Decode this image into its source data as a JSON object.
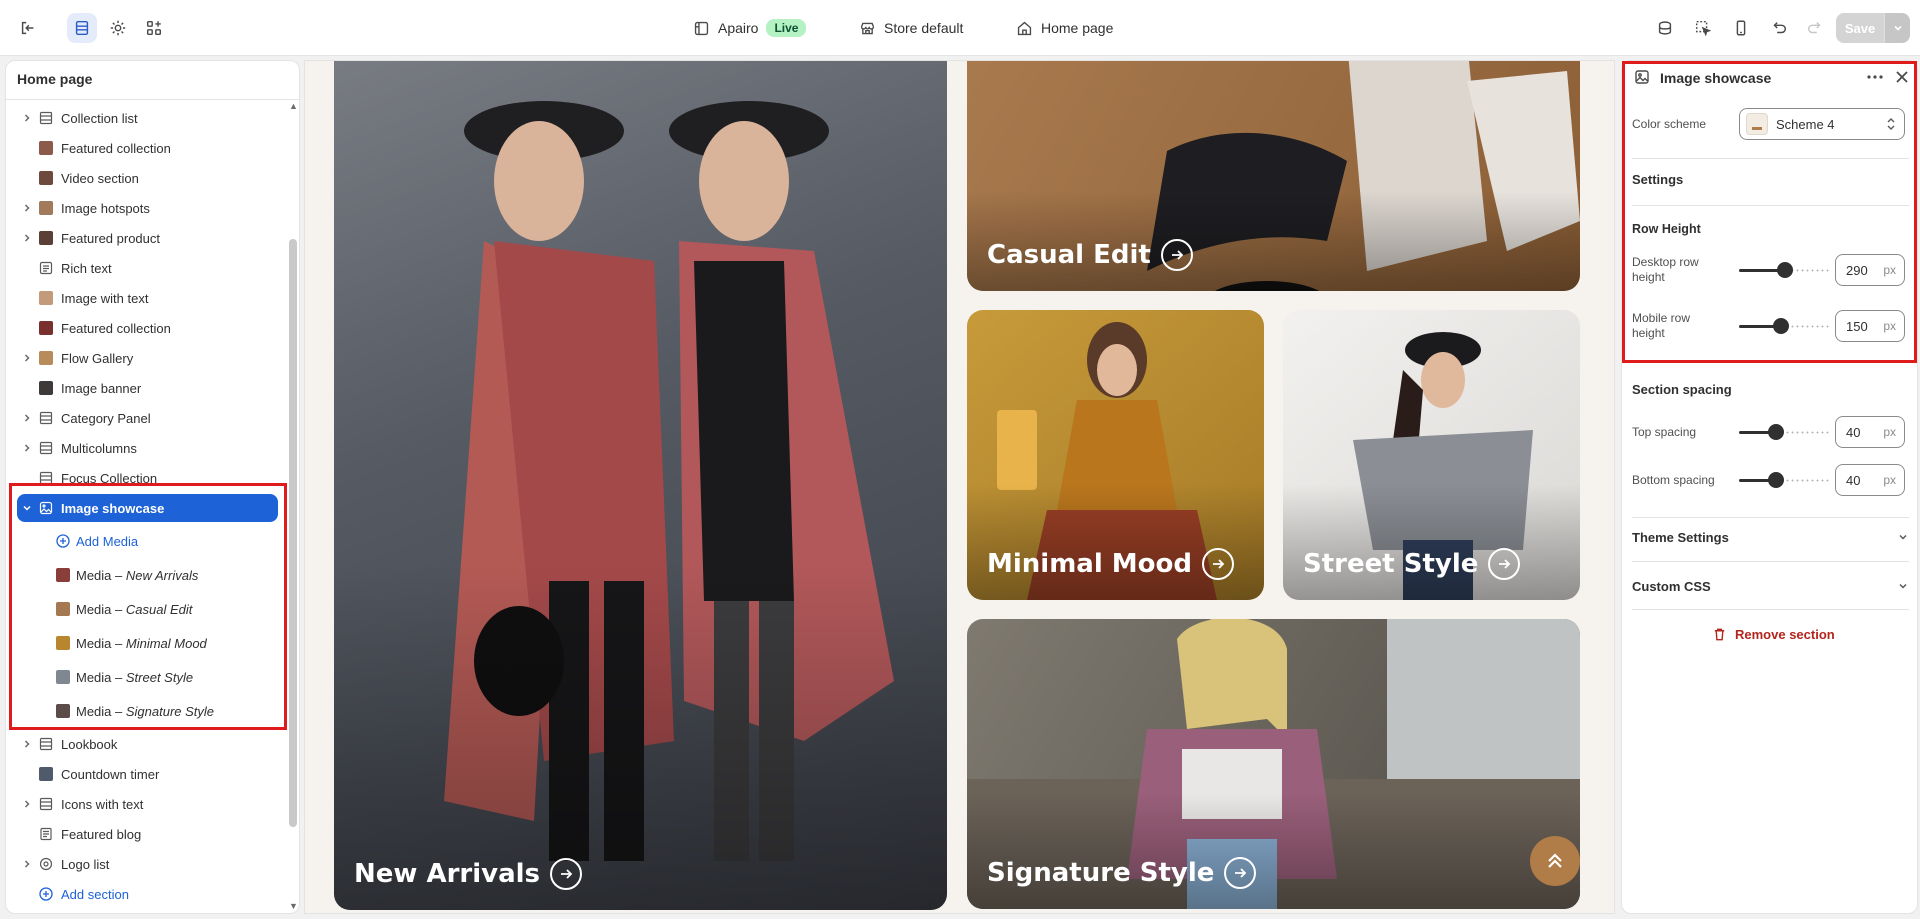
{
  "topbar": {
    "store_name": "Apairo",
    "status_badge": "Live",
    "theme_label": "Store default",
    "page_label": "Home page",
    "save_label": "Save"
  },
  "sidebar": {
    "title": "Home page",
    "items": [
      {
        "label": "Collection list",
        "expandable": true,
        "icon": "section-list-icon"
      },
      {
        "label": "Featured collection",
        "expandable": false,
        "icon": "thumbnail"
      },
      {
        "label": "Video section",
        "expandable": false,
        "icon": "thumbnail"
      },
      {
        "label": "Image hotspots",
        "expandable": true,
        "icon": "thumbnail"
      },
      {
        "label": "Featured product",
        "expandable": true,
        "icon": "thumbnail"
      },
      {
        "label": "Rich text",
        "expandable": false,
        "icon": "text-block-icon"
      },
      {
        "label": "Image with text",
        "expandable": false,
        "icon": "thumbnail"
      },
      {
        "label": "Featured collection",
        "expandable": false,
        "icon": "thumbnail"
      },
      {
        "label": "Flow Gallery",
        "expandable": true,
        "icon": "thumbnail"
      },
      {
        "label": "Image banner",
        "expandable": false,
        "icon": "thumbnail"
      },
      {
        "label": "Category Panel",
        "expandable": true,
        "icon": "section-list-icon"
      },
      {
        "label": "Multicolumns",
        "expandable": true,
        "icon": "section-list-icon"
      },
      {
        "label": "Focus Collection",
        "expandable": false,
        "icon": "section-list-icon"
      }
    ],
    "selected": {
      "label": "Image showcase",
      "icon": "image-showcase-icon"
    },
    "add_media": "Add Media",
    "media_prefix": "Media – ",
    "media_items": [
      "New Arrivals",
      "Casual Edit",
      "Minimal Mood",
      "Street Style",
      "Signature Style"
    ],
    "after_items": [
      {
        "label": "Lookbook",
        "expandable": true,
        "icon": "section-list-icon"
      },
      {
        "label": "Countdown timer",
        "expandable": false,
        "icon": "thumbnail"
      },
      {
        "label": "Icons with text",
        "expandable": true,
        "icon": "section-list-icon"
      },
      {
        "label": "Featured blog",
        "expandable": false,
        "icon": "blog-icon"
      },
      {
        "label": "Logo list",
        "expandable": true,
        "icon": "logo-list-icon"
      }
    ],
    "add_section": "Add section"
  },
  "preview": {
    "tiles": [
      {
        "title": "New Arrivals"
      },
      {
        "title": "Casual Edit"
      },
      {
        "title": "Minimal Mood"
      },
      {
        "title": "Street Style"
      },
      {
        "title": "Signature Style"
      }
    ]
  },
  "settings": {
    "title": "Image showcase",
    "color_scheme_label": "Color scheme",
    "color_scheme_value": "Scheme 4",
    "settings_heading": "Settings",
    "row_height_heading": "Row Height",
    "desktop_row_label_1": "Desktop row",
    "desktop_row_label_2": "height",
    "desktop_row_value": "290",
    "mobile_row_label_1": "Mobile row",
    "mobile_row_label_2": "height",
    "mobile_row_value": "150",
    "unit": "px",
    "section_spacing_heading": "Section spacing",
    "top_spacing_label": "Top spacing",
    "top_spacing_value": "40",
    "bottom_spacing_label": "Bottom spacing",
    "bottom_spacing_value": "40",
    "theme_settings_label": "Theme Settings",
    "custom_css_label": "Custom CSS",
    "remove_label": "Remove section"
  },
  "colors": {
    "accent": "#1d62d6",
    "highlight": "#e01b1b",
    "live_badge": "#b4f2c4",
    "fab": "#b07c48",
    "danger": "#b3261e"
  }
}
